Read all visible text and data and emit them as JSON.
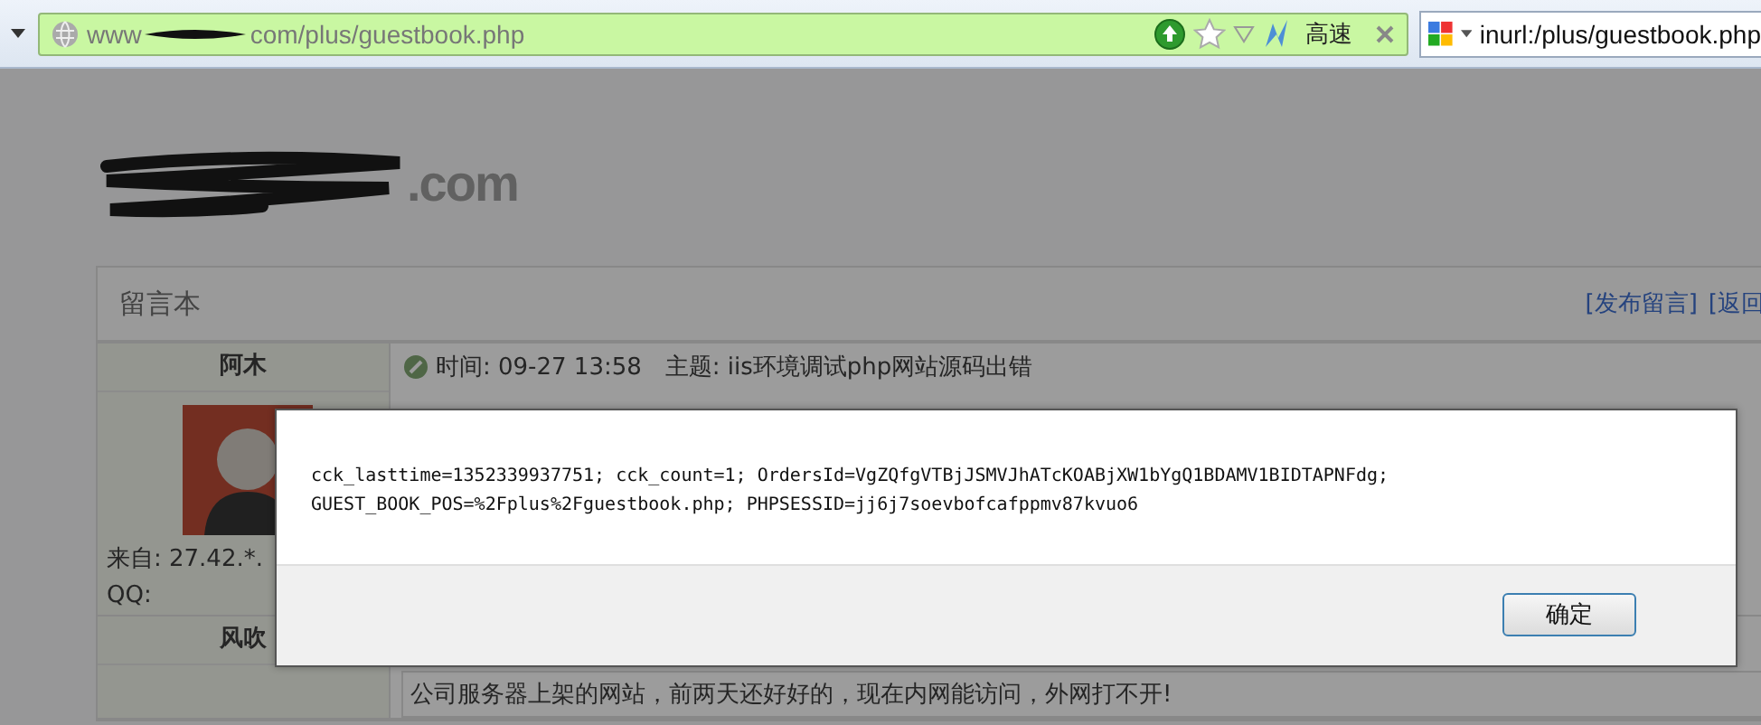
{
  "browser": {
    "url_start": "www",
    "url_end": "com/plus/guestbook.php",
    "speed_label": "高速",
    "search_query": "inurl:/plus/guestbook.php"
  },
  "page": {
    "logo_text": ".com",
    "panel_title": "留言本",
    "links": [
      "[发布留言]",
      "[返回"
    ],
    "entries": [
      {
        "name": "阿木",
        "from": "来自: 27.42.*.",
        "qq": "QQ:",
        "time": "时间: 09-27 13:58",
        "subject": "主题: iis环境调试php网站源码出错"
      },
      {
        "name": "风吹",
        "message": "公司服务器上架的网站，前两天还好好的，现在内网能访问，外网打不开!"
      }
    ]
  },
  "dialog": {
    "lines": [
      "cck_lasttime=1352339937751; cck_count=1; OrdersId=VgZQfgVTBjJSMVJhATcKOABjXW1bYgQ1BDAMV1BIDTAPNFdg;",
      "GUEST_BOOK_POS=%2Fplus%2Fguestbook.php; PHPSESSID=jj6j7soevbofcafppmv87kvuo6"
    ],
    "button": "确定"
  }
}
